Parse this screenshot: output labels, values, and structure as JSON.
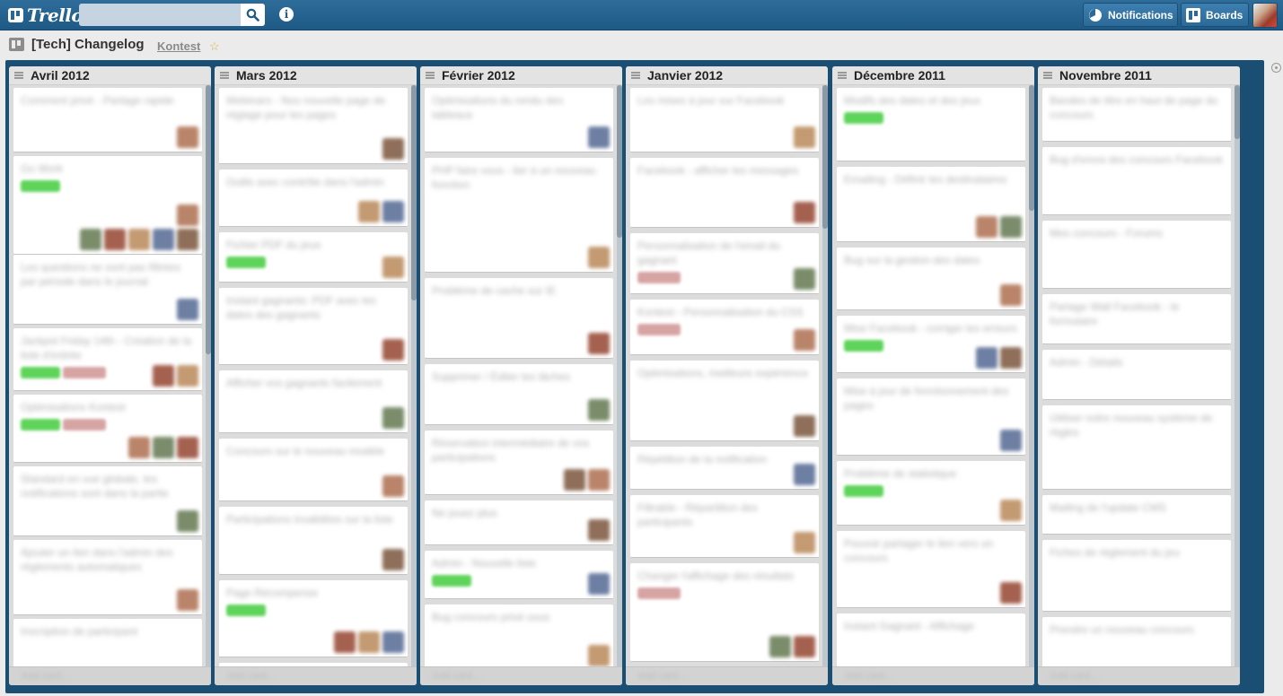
{
  "header": {
    "logo_text": "Trello",
    "search_placeholder": "",
    "notifications_label": "Notifications",
    "boards_label": "Boards",
    "info_label": "i"
  },
  "board": {
    "title": "[Tech] Changelog",
    "org": "Kontest"
  },
  "lists": [
    {
      "title": "Avril 2012",
      "footer": "Add card…",
      "cards": [
        {
          "text": "Comment privé - Partage rapide"
        },
        {
          "text": "Go Work"
        },
        {
          "text": "Les questions ne sont pas filtrées par période dans le journal"
        },
        {
          "text": "Jackpot Friday 14th - Création de la liste d'entrée"
        },
        {
          "text": "Optimisations Kontest"
        },
        {
          "text": "Standard en vue globale, les notifications sont dans la partie"
        },
        {
          "text": "Ajouter un lien dans l'admin des règlements automatiques"
        },
        {
          "text": "Inscription de participant"
        }
      ]
    },
    {
      "title": "Mars 2012",
      "footer": "Add card…",
      "cards": [
        {
          "text": "Webinars - Nos nouvelle page de réglage pour les pages"
        },
        {
          "text": "Outils avec contrôle dans l'admin"
        },
        {
          "text": "Fichier PDF du jeux"
        },
        {
          "text": "Instant gagnants: PDF avec les dates des gagnants"
        },
        {
          "text": "Afficher vos gagnants facilement"
        },
        {
          "text": "Concours sur le nouveau modèle"
        },
        {
          "text": "Participations invalidées sur la liste"
        },
        {
          "text": "Page Récompense"
        },
        {
          "text": "Table des options"
        }
      ]
    },
    {
      "title": "Février 2012",
      "footer": "Add card…",
      "cards": [
        {
          "text": "Optimisations du rendu des tableaux"
        },
        {
          "text": "PHP faire vous - lier à un nouveau fonction"
        },
        {
          "text": "Problème de cache sur IE"
        },
        {
          "text": "Supprimer / Éditer les tâches"
        },
        {
          "text": "Réservation intermédiaire de vos participations"
        },
        {
          "text": "Ne jouez plus"
        },
        {
          "text": "Admin - Nouvelle liste"
        },
        {
          "text": "Bug concours privé sous"
        }
      ]
    },
    {
      "title": "Janvier 2012",
      "footer": "Add card…",
      "cards": [
        {
          "text": "Les mises à jour sur Facebook"
        },
        {
          "text": "Facebook - afficher les messages"
        },
        {
          "text": "Personnalisation de l'email du gagnant"
        },
        {
          "text": "Kontest - Personnalisation du CSS"
        },
        {
          "text": "Optimisations, meilleure expérience"
        },
        {
          "text": "Répétition de la notification"
        },
        {
          "text": "Filtrable - Répartition des participants"
        },
        {
          "text": "Changer l'affichage des résultats"
        }
      ]
    },
    {
      "title": "Décembre 2011",
      "footer": "Add card…",
      "cards": [
        {
          "text": "Modifs des dates et des jeux"
        },
        {
          "text": "Emailing - Définir les destinataires"
        },
        {
          "text": "Bug sur la gestion des dates"
        },
        {
          "text": "Mise Facebook - corriger les erreurs"
        },
        {
          "text": "Mise à jour de fonctionnement des pages"
        },
        {
          "text": "Problème de statistique"
        },
        {
          "text": "Pouvoir partager le lien vers un concours"
        },
        {
          "text": "Instant Gagnant - Affichage"
        }
      ]
    },
    {
      "title": "Novembre 2011",
      "footer": "Add card…",
      "cards": [
        {
          "text": "Bandes de titre en haut de page du concours"
        },
        {
          "text": "Bug d'envoi des concours Facebook"
        },
        {
          "text": "Mes concours - Forums"
        },
        {
          "text": "Partage Wall Facebook - le formulaire"
        },
        {
          "text": "Admin - Détails"
        },
        {
          "text": "Utiliser notre nouveau système de règles"
        },
        {
          "text": "Mailing de l'update CMS"
        },
        {
          "text": "Fiches de réglement du jeu"
        },
        {
          "text": "Prendre un nouveau concours"
        }
      ]
    }
  ]
}
